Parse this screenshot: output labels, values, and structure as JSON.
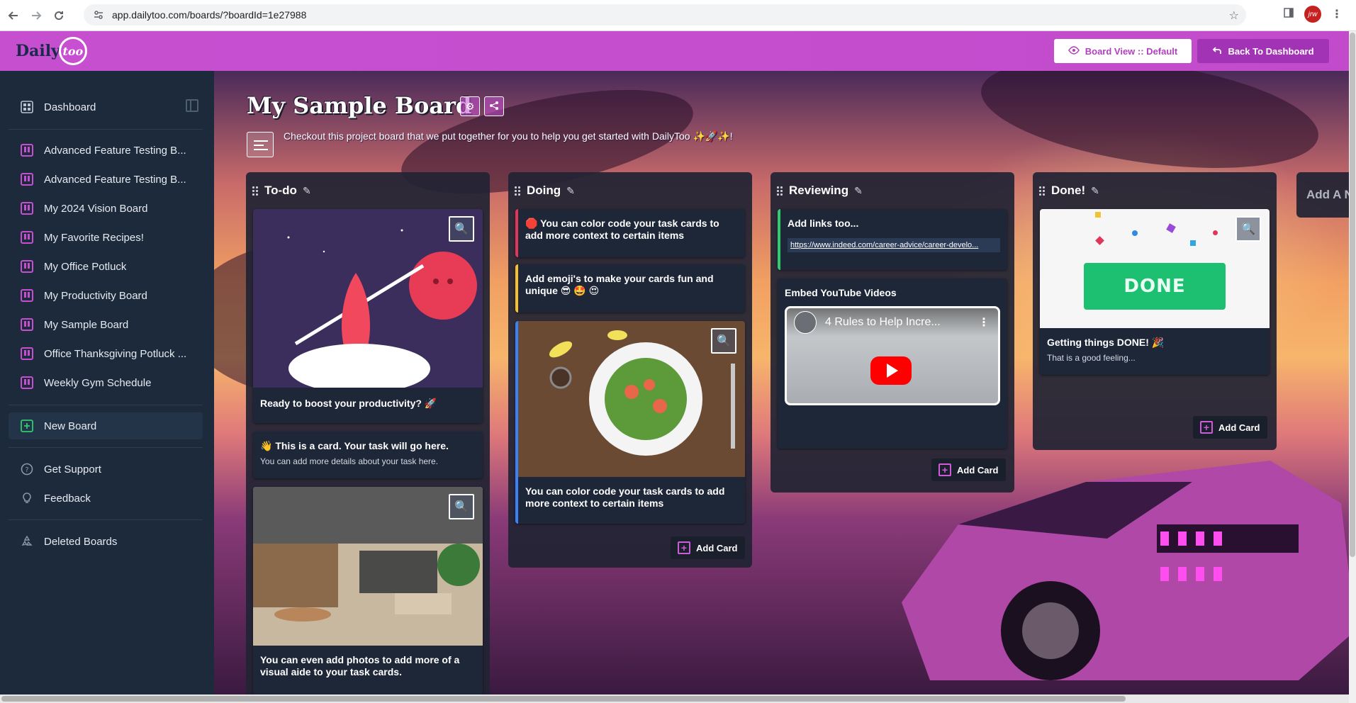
{
  "browser": {
    "url": "app.dailytoo.com/boards/?boardId=1e27988",
    "avatar_initials": "jrw"
  },
  "header": {
    "logo_daily": "Daily",
    "logo_too": "too",
    "board_view_label": "Board View :: Default",
    "back_label": "Back To Dashboard"
  },
  "sidebar": {
    "dashboard": "Dashboard",
    "boards": [
      "Advanced Feature Testing B...",
      "Advanced Feature Testing B...",
      "My 2024 Vision Board",
      "My Favorite Recipes!",
      "My Office Potluck",
      "My Productivity Board",
      "My Sample Board",
      "Office Thanksgiving Potluck ...",
      "Weekly Gym Schedule"
    ],
    "new_board": "New Board",
    "get_support": "Get Support",
    "feedback": "Feedback",
    "deleted_boards": "Deleted Boards"
  },
  "board": {
    "title": "My Sample Board",
    "description": "Checkout this project board that we put together for you to help you get started with DailyToo ✨🚀✨!",
    "add_list": "Add A N",
    "lists": [
      {
        "title": "To-do",
        "cards": [
          {
            "title": "Ready to boost your productivity? 🚀"
          },
          {
            "title": "👋 This is a card. Your task will go here.",
            "sub": "You can add more details about your task here."
          },
          {
            "title": "You can even add photos to add more of a visual aide to your task cards."
          }
        ]
      },
      {
        "title": "Doing",
        "cards": [
          {
            "title": "🛑 You can color code your task cards to add more context to certain items"
          },
          {
            "title": "Add emoji's to make your cards fun and unique 😎 🤩 😍"
          },
          {
            "title": "You can color code your task cards to add more context to certain items"
          }
        ],
        "add_card": "Add Card"
      },
      {
        "title": "Reviewing",
        "cards": [
          {
            "title": "Add links too...",
            "link": "https://www.indeed.com/career-advice/career-develo..."
          },
          {
            "title": "Embed YouTube Videos",
            "video_title": "4 Rules to Help Incre..."
          }
        ],
        "add_card": "Add Card"
      },
      {
        "title": "Done!",
        "cards": [
          {
            "title": "Getting things DONE! 🎉",
            "sub": "That is a good feeling...",
            "image_text": "DONE"
          }
        ],
        "add_card": "Add Card"
      }
    ]
  },
  "colors": {
    "brand": "#c64fd0",
    "sidebar": "#1c2a3c",
    "red_label": "#e0365a",
    "yellow_label": "#f2c230",
    "blue_label": "#3b82f6",
    "green_label": "#2fcc71"
  }
}
